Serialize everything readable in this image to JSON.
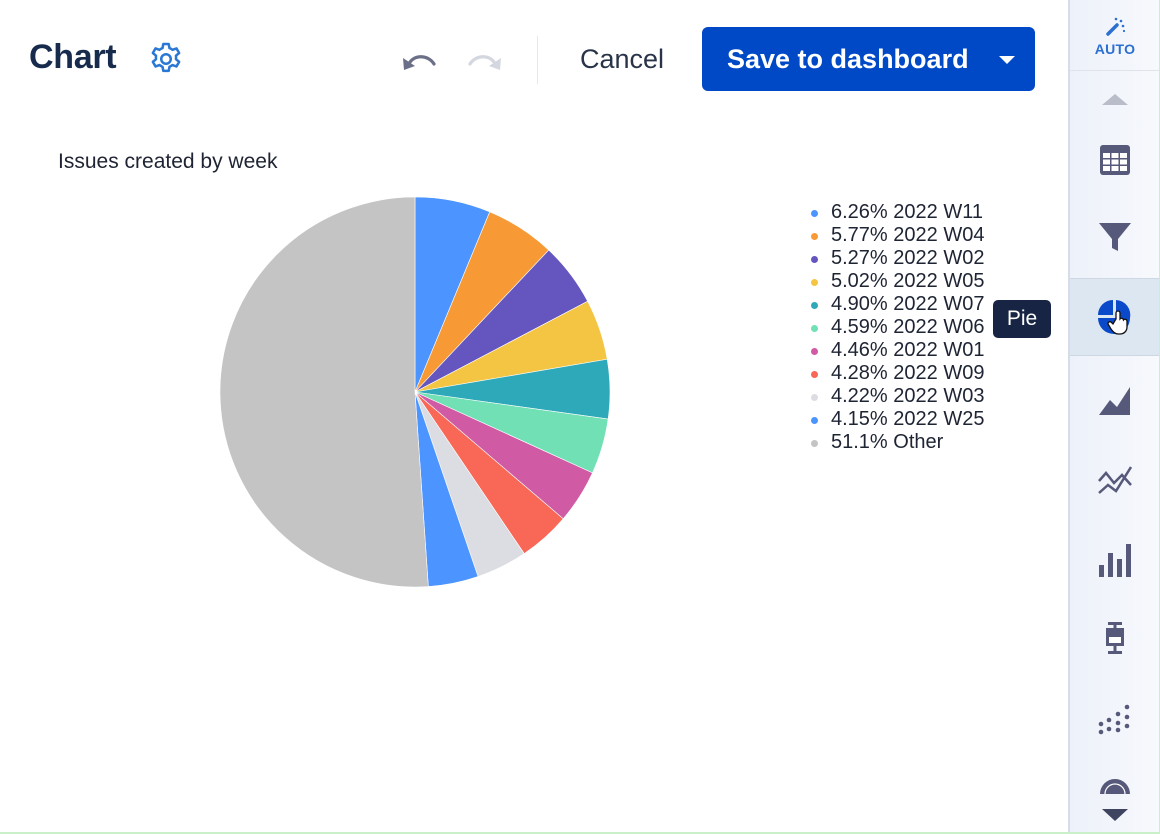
{
  "header": {
    "title": "Chart",
    "cancel_label": "Cancel",
    "save_label": "Save to dashboard",
    "icons": [
      "gear-icon",
      "undo-icon",
      "redo-icon",
      "caret-down-icon"
    ],
    "colors": {
      "primary": "#0049c6",
      "gear": "#2b78d4"
    }
  },
  "tooltip": {
    "text": "Pie"
  },
  "sidebar": {
    "auto_label": "AUTO",
    "items": [
      {
        "name": "auto",
        "icon": "magic-wand-icon",
        "label": "AUTO"
      },
      {
        "name": "table",
        "icon": "table-icon"
      },
      {
        "name": "funnel",
        "icon": "funnel-icon"
      },
      {
        "name": "pie",
        "icon": "pie-icon",
        "selected": true
      },
      {
        "name": "area",
        "icon": "area-chart-icon"
      },
      {
        "name": "line",
        "icon": "line-chart-icon"
      },
      {
        "name": "bar",
        "icon": "bar-chart-icon"
      },
      {
        "name": "box",
        "icon": "box-plot-icon"
      },
      {
        "name": "scatter",
        "icon": "scatter-icon"
      },
      {
        "name": "gauge",
        "icon": "gauge-icon"
      }
    ]
  },
  "chart_data": {
    "type": "pie",
    "title": "Issues created by week",
    "legend_position": "right",
    "start_angle": "12 o'clock, clockwise",
    "slices": [
      {
        "label": "2022 W11",
        "value": 6.26,
        "display": "6.26%",
        "color": "#4c94ff"
      },
      {
        "label": "2022 W04",
        "value": 5.77,
        "display": "5.77%",
        "color": "#f79a35"
      },
      {
        "label": "2022 W02",
        "value": 5.27,
        "display": "5.27%",
        "color": "#6455bf"
      },
      {
        "label": "2022 W05",
        "value": 5.02,
        "display": "5.02%",
        "color": "#f4c542"
      },
      {
        "label": "2022 W07",
        "value": 4.9,
        "display": "4.90%",
        "color": "#2ea9b9"
      },
      {
        "label": "2022 W06",
        "value": 4.59,
        "display": "4.59%",
        "color": "#72e0b5"
      },
      {
        "label": "2022 W01",
        "value": 4.46,
        "display": "4.46%",
        "color": "#d05aa3"
      },
      {
        "label": "2022 W09",
        "value": 4.28,
        "display": "4.28%",
        "color": "#f96757"
      },
      {
        "label": "2022 W03",
        "value": 4.22,
        "display": "4.22%",
        "color": "#dcdde2"
      },
      {
        "label": "2022 W25",
        "value": 4.15,
        "display": "4.15%",
        "color": "#4c94ff"
      },
      {
        "label": "Other",
        "value": 51.1,
        "display": "51.1%",
        "color": "#c4c4c4"
      }
    ]
  }
}
